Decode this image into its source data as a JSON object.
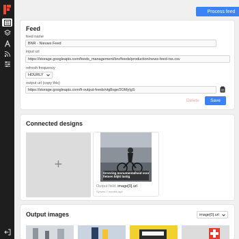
{
  "header": {
    "process_label": "Process feed"
  },
  "sidebar": {
    "icons": [
      "list-icon",
      "layers-icon",
      "text-icon",
      "rss-icon",
      "sliders-icon"
    ],
    "logout_icon": "logout-icon"
  },
  "feed": {
    "title": "Feed",
    "name_label": "feed name",
    "name_value": "BNR - Nieuws Feed",
    "input_label": "input url",
    "input_value": "https://storage.googleapis.com/feeds_management/bnr/feeds/production/news-feed-rss.csv",
    "frequency_label": "refresh frequency",
    "frequency_value": "HOURLY",
    "output_label": "output url (copy this)",
    "output_value": "https://storage.googleapis.com/fi-output-feeds/vlg8sge/2OMyIgS",
    "delete_label": "Delete",
    "save_label": "Save"
  },
  "designs": {
    "title": "Connected designs",
    "add_symbol": "+",
    "caption": "fervering monumentalheid voor fietsen blijkt lastig",
    "output_field_label": "Output field:",
    "output_field_value": "image[0].url",
    "synced": "Synced 7 months ago"
  },
  "output_images": {
    "title": "Output images",
    "select_value": "image[0].url"
  },
  "colors": {
    "accent": "#3b82f6",
    "sidebar": "#1e1e1e",
    "logo": "#e94b2b"
  }
}
